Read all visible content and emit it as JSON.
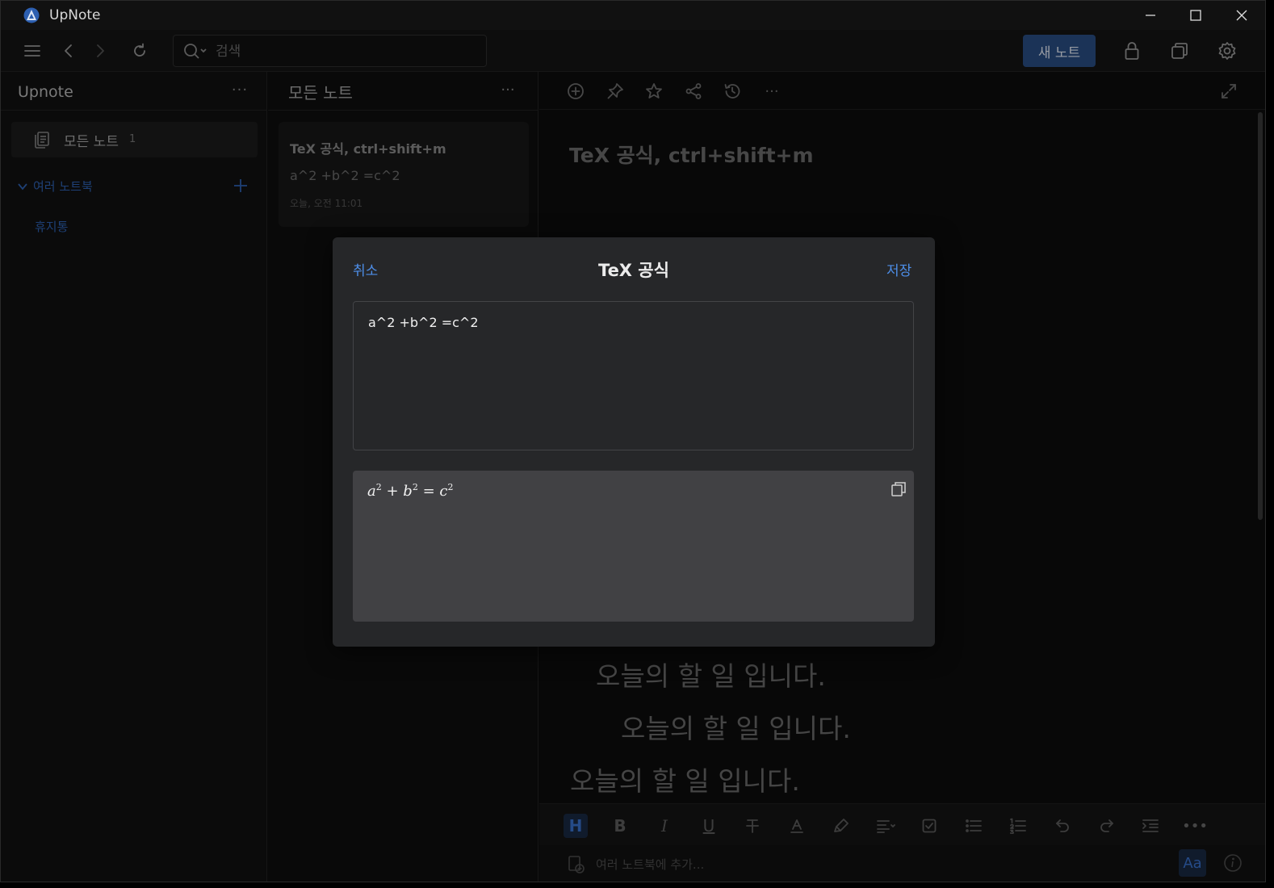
{
  "window": {
    "title": "UpNote"
  },
  "toolbar": {
    "search_placeholder": "검색",
    "new_note_label": "새 노트"
  },
  "sidebar": {
    "title": "Upnote",
    "more": "···",
    "all_notes_label": "모든 노트",
    "all_notes_count": "1",
    "notebooks_label": "여러 노트북",
    "trash_label": "휴지통"
  },
  "notelist": {
    "title": "모든 노트",
    "more": "···",
    "notes": [
      {
        "title": "TeX 공식, ctrl+shift+m",
        "preview": "a^2 +b^2 =c^2",
        "date": "오늘, 오전 11:01"
      }
    ]
  },
  "editor": {
    "note_title": "TeX 공식, ctrl+shift+m",
    "lines": [
      "오늘의 할 일 입니다.",
      "오늘의 할 일 입니다.",
      "오늘의 할 일 입니다."
    ],
    "footer_add_notebook": "여러 노트북에 추가...",
    "font_button": "Aa",
    "heading_button": "H",
    "bold_button": "B",
    "italic_button": "I",
    "underline_button": "U"
  },
  "modal": {
    "cancel_label": "취소",
    "title": "TeX 공식",
    "save_label": "저장",
    "tex_input": "a^2 +b^2 =c^2",
    "rendered": {
      "a": "a",
      "b": "b",
      "c": "c",
      "exp": "2",
      "plus": "+",
      "eq": "="
    }
  },
  "colors": {
    "accent": "#4d8ee8",
    "new_note_bg": "#2a4f86",
    "modal_bg": "#262729",
    "preview_bg": "#414144"
  }
}
